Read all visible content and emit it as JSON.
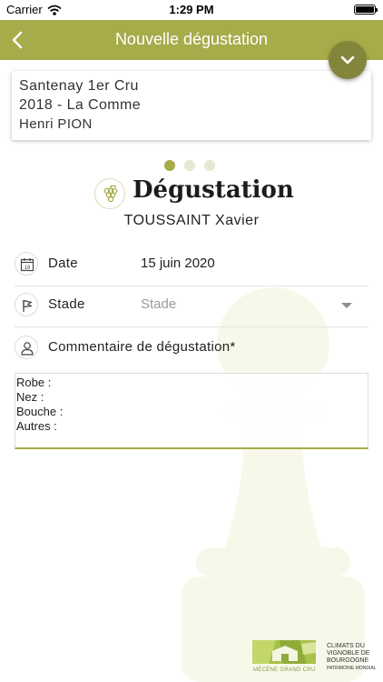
{
  "status_bar": {
    "carrier": "Carrier",
    "time": "1:29 PM"
  },
  "nav": {
    "title": "Nouvelle dégustation"
  },
  "wine": {
    "name": "Santenay 1er Cru",
    "vintage_climat": "2018 - La Comme",
    "producer": "Henri PION"
  },
  "pager": {
    "page_count": 3,
    "current_page": 1
  },
  "tasting": {
    "title": "Dégustation",
    "taster": "TOUSSAINT Xavier"
  },
  "form": {
    "date_label": "Date",
    "date_value": "15 juin 2020",
    "stade_label": "Stade",
    "stade_placeholder": "Stade",
    "comment_label": "Commentaire de dégustation*",
    "comment_value": "Robe :\nNez :\nBouche :\nAutres :"
  },
  "footer": {
    "mecene_caption": "MÉCÈNE GRAND CRU",
    "climats_title": "CLIMATS DU VIGNOBLE DE BOURGOGNE",
    "climats_subtitle": "PATRIMOINE MONDIAL"
  },
  "colors": {
    "accent": "#a7ab4a",
    "accent_dark": "#83863a",
    "dot_inactive": "#e6e8cf",
    "watermark": "#f7f8ea"
  },
  "icons": {
    "back": "chevron-left-icon",
    "collapse": "chevron-down-icon",
    "grape": "grape-icon",
    "date": "calendar-icon",
    "stade": "flag-icon",
    "comment": "person-icon"
  }
}
